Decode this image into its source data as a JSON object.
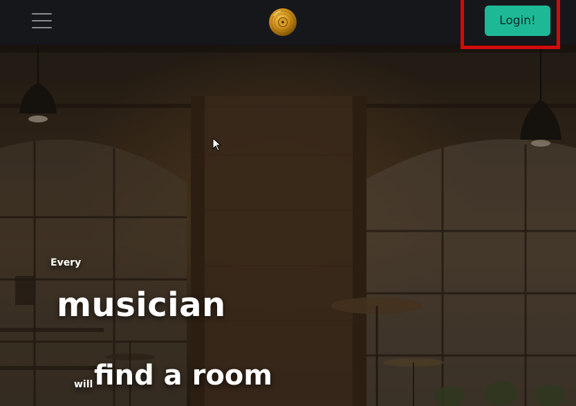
{
  "navbar": {
    "menu_icon": "hamburger-menu-icon",
    "logo_icon": "gold-record-logo-icon",
    "login_label": "Login!",
    "login_color": "#1db997",
    "highlight_color": "#d10b0b"
  },
  "hero": {
    "line1": "Every",
    "line2": "musician",
    "line3_small": "will",
    "line3_large": "find a room"
  },
  "cursor_icon": "mouse-pointer-icon"
}
